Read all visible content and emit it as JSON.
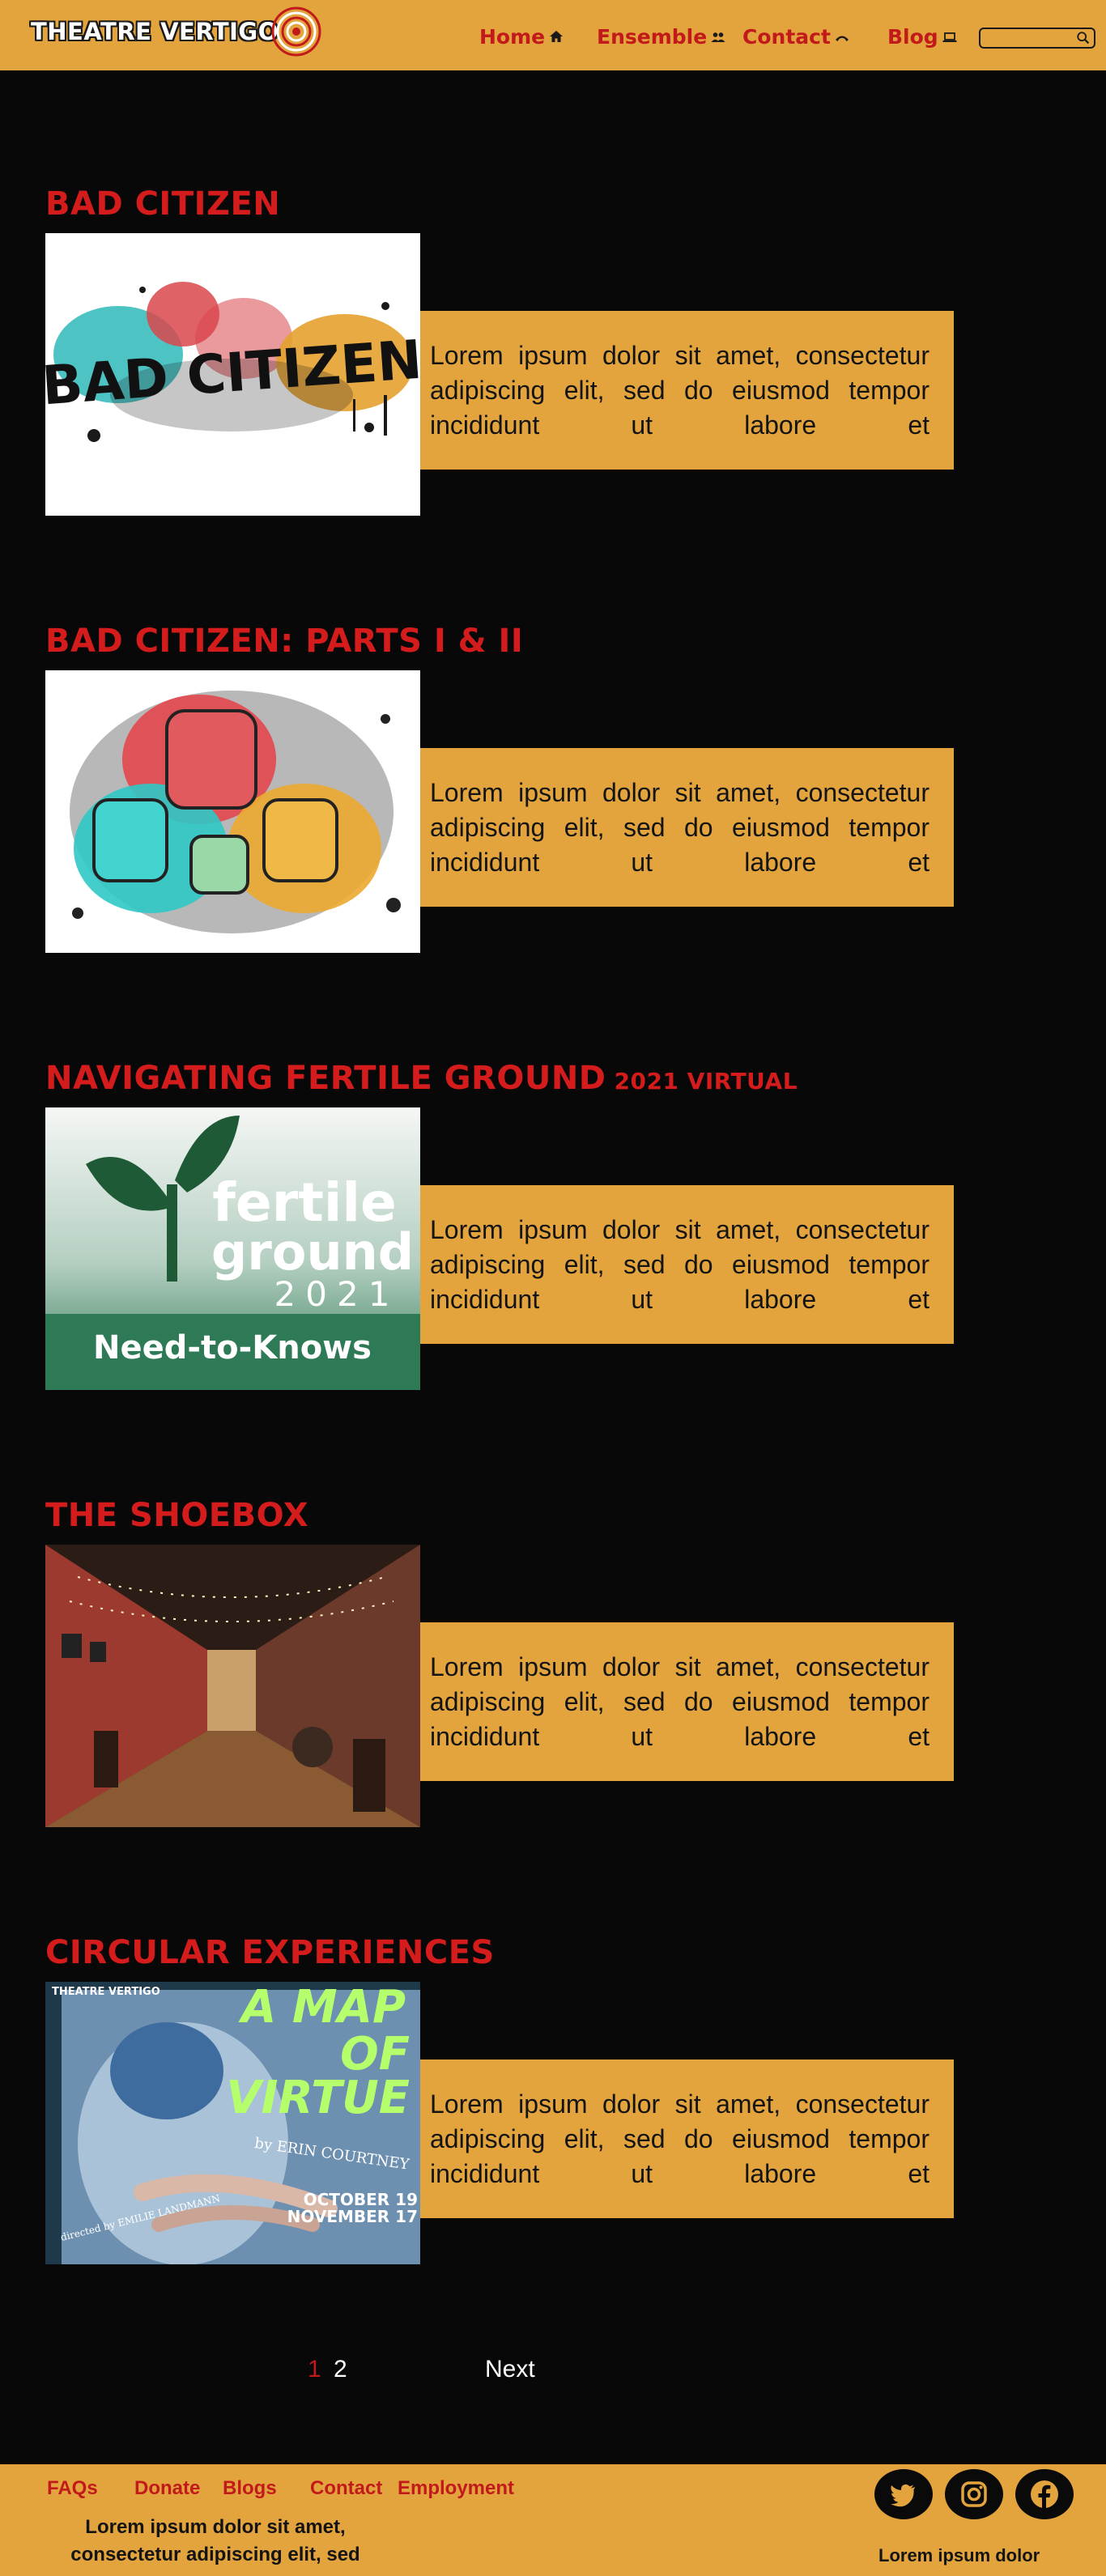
{
  "header": {
    "logo_text": "THEATRE VERTIGO",
    "nav": [
      {
        "label": "Home",
        "icon": "home-icon"
      },
      {
        "label": "Ensemble",
        "icon": "people-icon"
      },
      {
        "label": "Contact",
        "icon": "phone-icon"
      },
      {
        "label": "Blog",
        "icon": "laptop-icon"
      }
    ],
    "search": {
      "value": "",
      "placeholder": "",
      "icon": "search-icon"
    }
  },
  "posts": [
    {
      "title": "BAD CITIZEN",
      "title_suffix": "",
      "image_text": "BAD CITIZEN",
      "text": "Lorem ipsum dolor sit amet, consectetur adipiscing elit, sed do eiusmod tempor incididunt ut labore et"
    },
    {
      "title": "BAD CITIZEN: PARTS I & II",
      "title_suffix": "",
      "image_text": "",
      "text": "Lorem ipsum dolor sit amet, consectetur adipiscing elit, sed do eiusmod tempor incididunt ut labore et"
    },
    {
      "title": "NAVIGATING FERTILE GROUND",
      "title_suffix": "2021 VIRTUAL",
      "image_text_1": "fertile",
      "image_text_2": "ground",
      "image_text_3": "2021",
      "image_text_4": "Need-to-Knows",
      "text": "Lorem ipsum dolor sit amet, consectetur adipiscing elit, sed do eiusmod tempor incididunt ut labore et"
    },
    {
      "title": "THE SHOEBOX",
      "title_suffix": "",
      "text": "Lorem ipsum dolor sit amet, consectetur adipiscing elit, sed do eiusmod tempor incididunt ut labore et"
    },
    {
      "title": "CIRCULAR EXPERIENCES",
      "title_suffix": "",
      "image_text_1": "THEATRE VERTIGO",
      "image_text_2": "A MAP",
      "image_text_3": "OF",
      "image_text_4": "VIRTUE",
      "image_text_5": "by ERIN COURTNEY",
      "image_text_6": "directed by EMILIE LANDMANN",
      "image_text_7": "OCTOBER 19",
      "image_text_8": "NOVEMBER 17",
      "text": "Lorem ipsum dolor sit amet, consectetur adipiscing elit, sed do eiusmod tempor incididunt ut labore et"
    }
  ],
  "pagination": {
    "page_1": "1",
    "page_2": "2",
    "next": "Next",
    "current_color": "#c21a1a"
  },
  "footer": {
    "links": [
      "FAQs",
      "Donate",
      "Blogs",
      "Contact",
      "Employment"
    ],
    "text": "Lorem ipsum dolor sit amet, consectetur adipiscing elit, sed",
    "social_icons": [
      "twitter-icon",
      "instagram-icon",
      "facebook-icon"
    ],
    "right_text": "Lorem ipsum dolor"
  },
  "colors": {
    "accent": "#e3a43d",
    "title_red": "#d41c1c",
    "link_red": "#c21a1a",
    "background": "#080808"
  }
}
